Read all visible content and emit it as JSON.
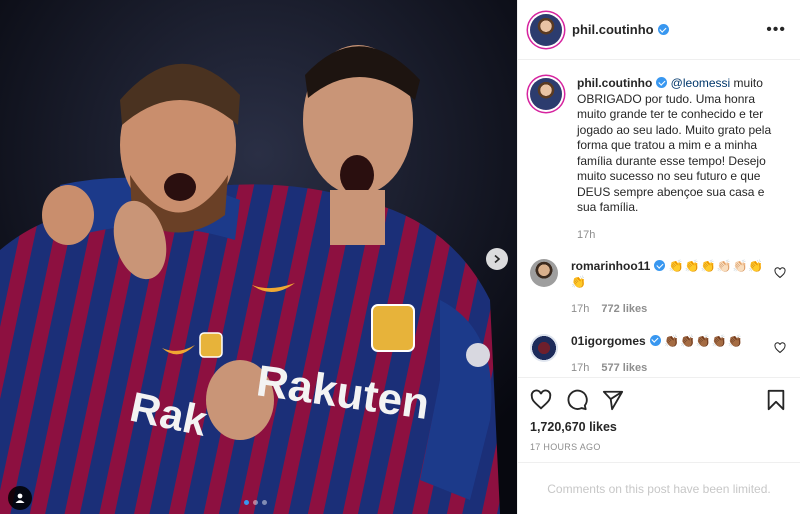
{
  "post": {
    "author": "phil.coutinho",
    "caption_mention": "@leomessi",
    "caption_text": " muito OBRIGADO por tudo. Uma honra muito grande ter te conhecido e ter jogado ao seu lado. Muito grato pela forma que tratou a mim e a minha família durante esse tempo! Desejo muito sucesso no seu futuro e que DEUS sempre abençoe sua casa e sua família.",
    "caption_time": "17h",
    "likes": "1,720,670 likes",
    "time_ago": "17 HOURS AGO",
    "comments_limited": "Comments on this post have been limited."
  },
  "photo": {
    "shirt_text_left": "Rak",
    "shirt_text_right": "Rakuten"
  },
  "comments": [
    {
      "user": "romarinhoo11",
      "text": "👏👏👏👏🏻👏🏻👏👏",
      "time": "17h",
      "likes": "772 likes"
    },
    {
      "user": "01igorgomes",
      "text": "👏🏾👏🏾👏🏾👏🏾👏🏾",
      "time": "17h",
      "likes": "577 likes"
    }
  ],
  "icons": [
    "more-icon",
    "heart-icon",
    "comment-icon",
    "share-icon",
    "bookmark-icon",
    "next-arrow-icon",
    "tag-user-icon"
  ],
  "colors": {
    "verified": "#3897f0",
    "mention": "#00376b",
    "muted": "#8e8e8e",
    "barca_blue": "#1c3a8a",
    "barca_red": "#a5113f"
  }
}
